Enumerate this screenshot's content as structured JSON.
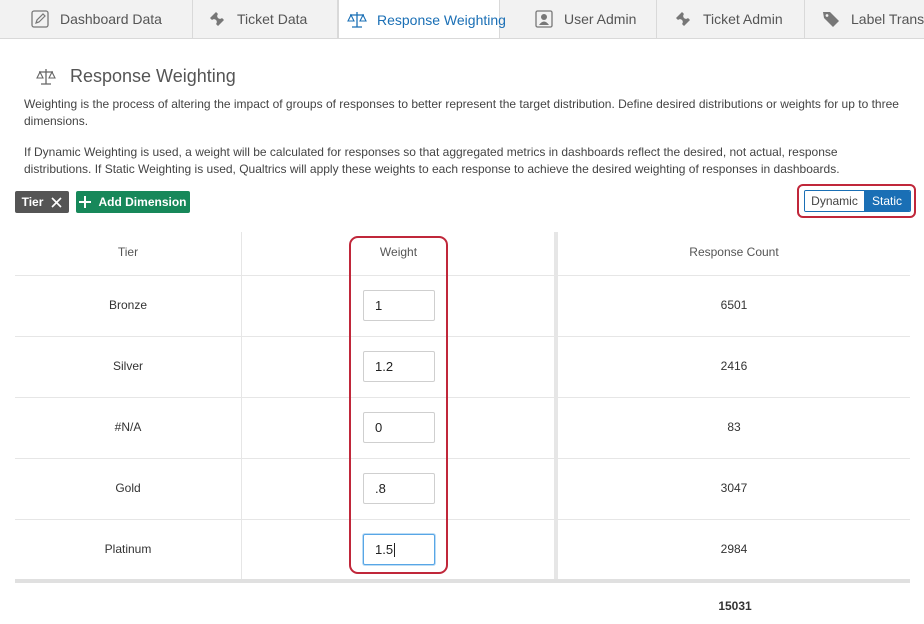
{
  "tabs": [
    {
      "label": "Dashboard Data",
      "icon": "pencil-icon"
    },
    {
      "label": "Ticket Data",
      "icon": "ticket-icon"
    },
    {
      "label": "Response Weighting",
      "icon": "scale-icon",
      "active": true
    },
    {
      "label": "User Admin",
      "icon": "user-card-icon"
    },
    {
      "label": "Ticket Admin",
      "icon": "ticket-icon"
    },
    {
      "label": "Label Transla",
      "icon": "tag-icon"
    }
  ],
  "page": {
    "title": "Response Weighting",
    "title_icon": "scale-icon",
    "desc1": "Weighting is the process of altering the impact of groups of responses to better represent the target distribution. Define desired distributions or weights for up to three dimensions.",
    "desc2": "If Dynamic Weighting is used, a weight will be calculated for responses so that aggregated metrics in dashboards reflect the desired, not actual, response distributions. If Static Weighting is used, Qualtrics will apply these weights to each response to achieve the desired weighting of responses in dashboards."
  },
  "toolbar": {
    "dimension_chip": "Tier",
    "add_dimension_label": "Add Dimension",
    "mode_options": [
      "Dynamic",
      "Static"
    ],
    "selected_mode": "Static"
  },
  "table": {
    "headers": {
      "tier": "Tier",
      "weight": "Weight",
      "count": "Response Count"
    },
    "rows": [
      {
        "tier": "Bronze",
        "weight": "1",
        "count": "6501"
      },
      {
        "tier": "Silver",
        "weight": "1.2",
        "count": "2416"
      },
      {
        "tier": "#N/A",
        "weight": "0",
        "count": "83"
      },
      {
        "tier": "Gold",
        "weight": ".8",
        "count": "3047"
      },
      {
        "tier": "Platinum",
        "weight": "1.5",
        "count": "2984"
      }
    ],
    "total": "15031"
  },
  "colors": {
    "accent": "#1a6fb5",
    "add_button": "#17885a",
    "highlight_outline": "#c0273a",
    "chip": "#555555"
  }
}
